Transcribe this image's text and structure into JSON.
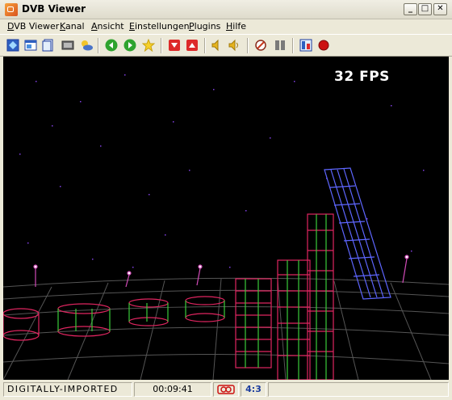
{
  "window": {
    "title": "DVB Viewer"
  },
  "menu": [
    {
      "label": "DVB Viewer",
      "accel": "D",
      "rest": "VB Viewer"
    },
    {
      "label": "Kanal",
      "accel": "K",
      "rest": "anal"
    },
    {
      "label": "Ansicht",
      "accel": "A",
      "rest": "nsicht"
    },
    {
      "label": "Einstellungen",
      "accel": "E",
      "rest": "instellungen"
    },
    {
      "label": "Plugins",
      "accel": "P",
      "rest": "lugins"
    },
    {
      "label": "Hilfe",
      "accel": "H",
      "rest": "ilfe"
    }
  ],
  "toolbar": {
    "icons": [
      "channel-list-icon",
      "epg-icon",
      "teletext-icon",
      "osd-icon",
      "weather-icon",
      "back-icon",
      "forward-icon",
      "favorites-icon",
      "channel-down-icon",
      "channel-up-icon",
      "volume-down-icon",
      "volume-up-icon",
      "mute-icon",
      "stop-icon",
      "options-icon",
      "record-icon"
    ]
  },
  "video": {
    "fps": "32 FPS"
  },
  "status": {
    "channel": "DIGITALLY-IMPORTED",
    "time": "00:09:41",
    "aspect": "4:3"
  },
  "colors": {
    "accent_blue": "#1B3C9E",
    "record_red": "#CC1111"
  }
}
